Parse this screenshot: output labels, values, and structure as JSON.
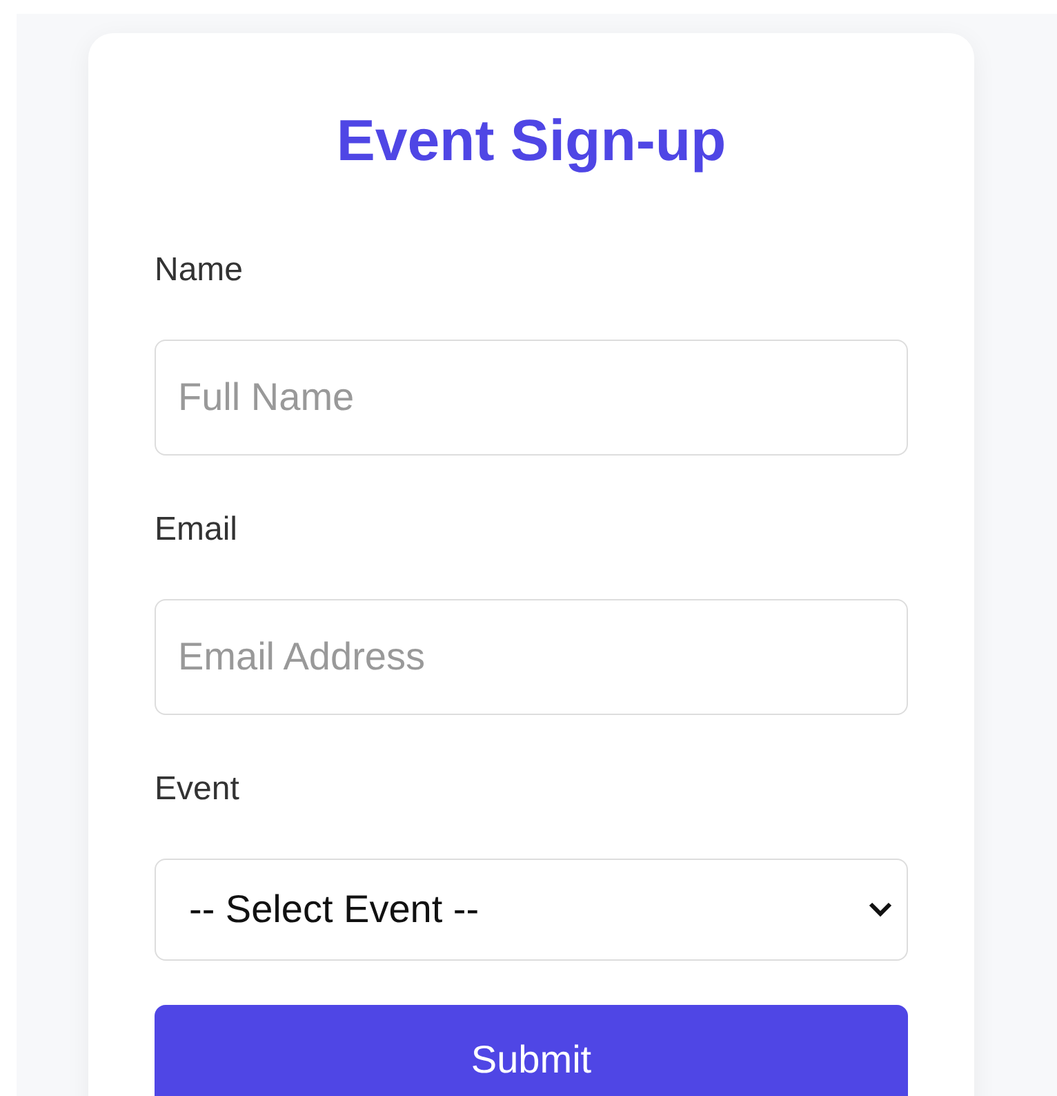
{
  "form": {
    "title": "Event Sign-up",
    "fields": [
      {
        "kind": "text",
        "label": "Name",
        "placeholder": "Full Name"
      },
      {
        "kind": "text",
        "label": "Email",
        "placeholder": "Email Address"
      },
      {
        "kind": "select",
        "label": "Event",
        "value": "-- Select Event --"
      }
    ],
    "submit": "Submit"
  }
}
